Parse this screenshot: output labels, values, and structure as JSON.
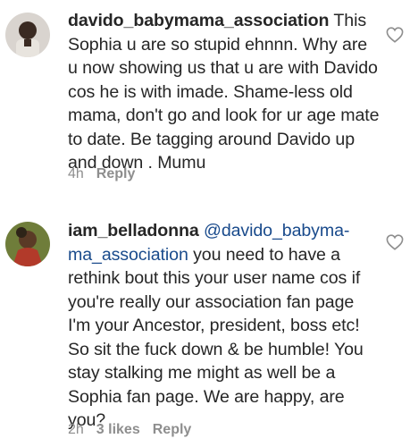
{
  "comments": [
    {
      "username": "davido_babymama_association",
      "text": " This Sophia u are so stupid ehnnn. Why are u now showing us that u are with Davido cos he is with imade. Shame-less old mama, don't go and look for ur age mate to date. Be tagging around Davido up and down . Mumu",
      "time": "4h",
      "likes": "",
      "reply_label": "Reply"
    },
    {
      "username": "iam_belladonna",
      "mention": "@davido_babyma-ma_association",
      "text": " you need to have a rethink bout this your user name cos if you're really our association fan page I'm your Ancestor, president, boss etc! So sit the fuck down & be humble! You stay stalking me might as well be a Sophia fan page. We are happy, are you?",
      "time": "2h",
      "likes": "3 likes",
      "reply_label": "Reply"
    }
  ],
  "icons": {
    "like": "heart-outline-icon"
  },
  "colors": {
    "text": "#262626",
    "meta": "#8e8e8e",
    "mention": "#1a4b8c"
  }
}
